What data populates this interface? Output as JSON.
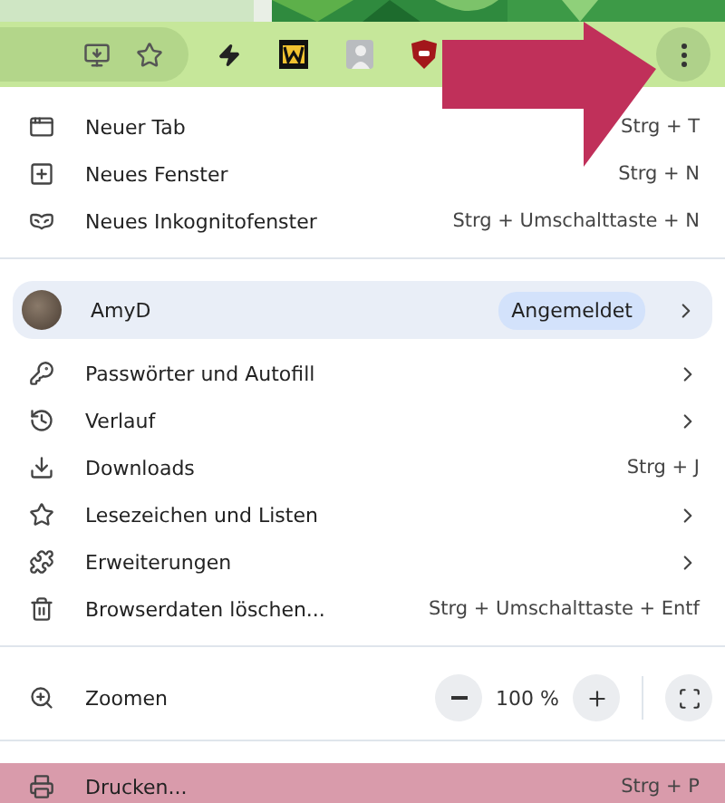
{
  "menu": [
    {
      "kind": "item",
      "label": "Neuer Tab",
      "shortcut": "Strg + T",
      "selected": false
    },
    {
      "kind": "item",
      "label": "Neues Fenster",
      "shortcut": "Strg + N",
      "selected": false
    },
    {
      "kind": "item",
      "label": "Neues Inkognitofenster",
      "shortcut": "Strg + Umschalttaste + N",
      "selected": false
    },
    {
      "kind": "divider"
    },
    {
      "kind": "profile",
      "label": "AmyD",
      "badge": "Angemeldet",
      "submenu": true,
      "selected": false
    },
    {
      "kind": "item",
      "label": "Passwörter und Autofill",
      "submenu": true,
      "selected": false
    },
    {
      "kind": "item",
      "label": "Verlauf",
      "submenu": true,
      "selected": false
    },
    {
      "kind": "item",
      "label": "Downloads",
      "shortcut": "Strg + J",
      "selected": false
    },
    {
      "kind": "item",
      "label": "Lesezeichen und Listen",
      "submenu": true,
      "selected": false
    },
    {
      "kind": "item",
      "label": "Erweiterungen",
      "submenu": true,
      "selected": false
    },
    {
      "kind": "item",
      "label": "Browserdaten löschen...",
      "shortcut": "Strg + Umschalttaste + Entf",
      "selected": false
    },
    {
      "kind": "divider"
    },
    {
      "kind": "zoom",
      "label": "Zoomen",
      "value": "100 %"
    },
    {
      "kind": "divider"
    },
    {
      "kind": "item",
      "label": "Drucken...",
      "shortcut": "Strg + P",
      "selected": true
    }
  ]
}
